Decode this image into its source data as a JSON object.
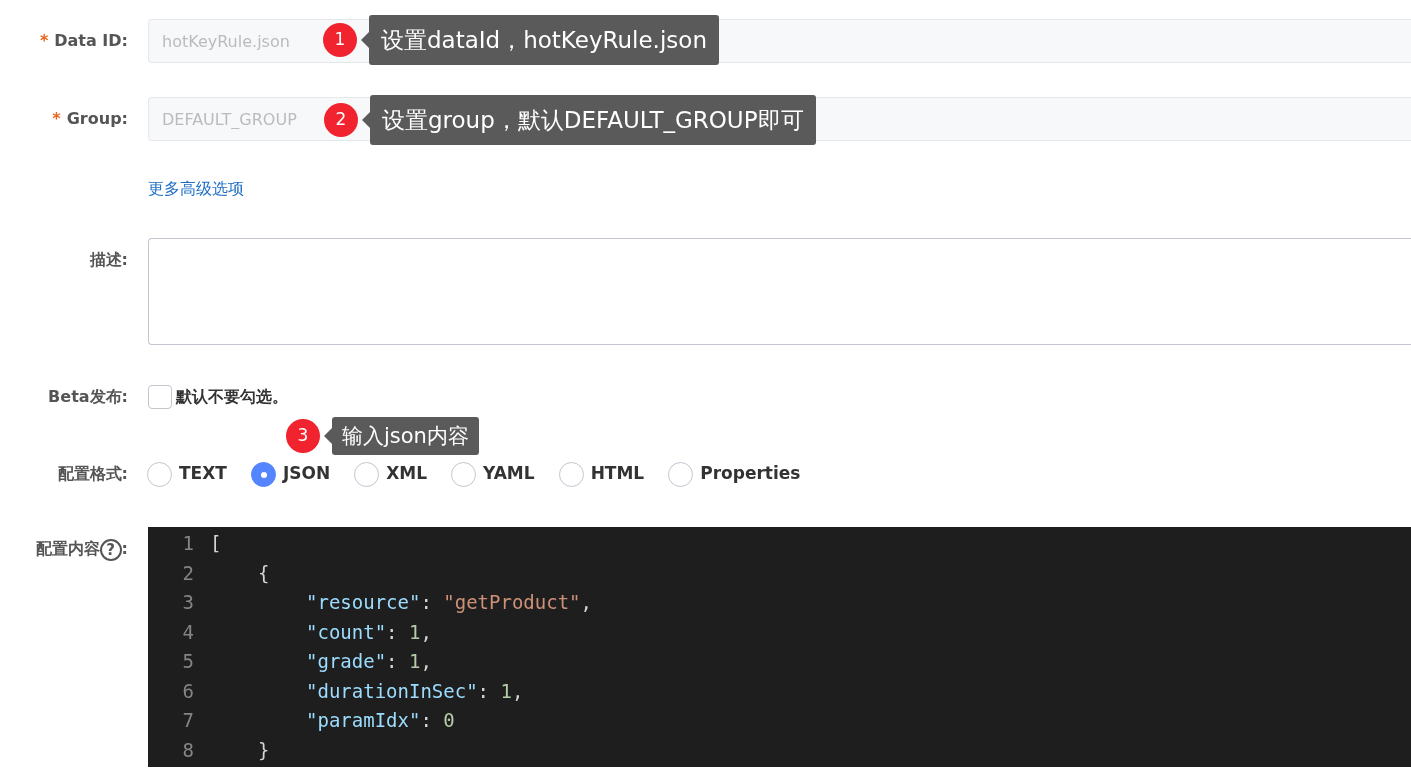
{
  "fields": [
    {
      "label": "Data ID:",
      "required_mark": "*",
      "value": "hotKeyRule.json",
      "disabled": true
    },
    {
      "label": "Group:",
      "required_mark": "*",
      "value": "DEFAULT_GROUP",
      "disabled": true
    }
  ],
  "advanced_link": "更多高级选项",
  "description": {
    "label": "描述:"
  },
  "beta": {
    "label": "Beta发布:",
    "checked": false,
    "text": "默认不要勾选。"
  },
  "format": {
    "label": "配置格式:",
    "options": [
      {
        "label": "TEXT",
        "selected": false
      },
      {
        "label": "JSON",
        "selected": true
      },
      {
        "label": "XML",
        "selected": false
      },
      {
        "label": "YAML",
        "selected": false
      },
      {
        "label": "HTML",
        "selected": false
      },
      {
        "label": "Properties",
        "selected": false
      }
    ]
  },
  "content": {
    "label": "配置内容",
    "help": "?",
    "suffix": ":",
    "lines": [
      {
        "number": "1",
        "tokens": [
          {
            "kind": "punct",
            "text": "["
          }
        ],
        "children": [
          {
            "number": "2",
            "tokens": [
              {
                "kind": "punct",
                "text": "{"
              }
            ],
            "children": [
              {
                "number": "3",
                "tokens": [
                  {
                    "kind": "key",
                    "text": "\"resource\""
                  },
                  {
                    "kind": "punct",
                    "text": ": "
                  },
                  {
                    "kind": "string",
                    "text": "\"getProduct\""
                  },
                  {
                    "kind": "punct",
                    "text": ","
                  }
                ]
              },
              {
                "number": "4",
                "tokens": [
                  {
                    "kind": "key",
                    "text": "\"count\""
                  },
                  {
                    "kind": "punct",
                    "text": ": "
                  },
                  {
                    "kind": "number",
                    "text": "1"
                  },
                  {
                    "kind": "punct",
                    "text": ","
                  }
                ]
              },
              {
                "number": "5",
                "tokens": [
                  {
                    "kind": "key",
                    "text": "\"grade\""
                  },
                  {
                    "kind": "punct",
                    "text": ": "
                  },
                  {
                    "kind": "number",
                    "text": "1"
                  },
                  {
                    "kind": "punct",
                    "text": ","
                  }
                ]
              },
              {
                "number": "6",
                "tokens": [
                  {
                    "kind": "key",
                    "text": "\"durationInSec\""
                  },
                  {
                    "kind": "punct",
                    "text": ": "
                  },
                  {
                    "kind": "number",
                    "text": "1"
                  },
                  {
                    "kind": "punct",
                    "text": ","
                  }
                ]
              },
              {
                "number": "7",
                "tokens": [
                  {
                    "kind": "key",
                    "text": "\"paramIdx\""
                  },
                  {
                    "kind": "punct",
                    "text": ": "
                  },
                  {
                    "kind": "number",
                    "text": "0"
                  }
                ]
              }
            ]
          },
          {
            "number": "8",
            "tokens": [
              {
                "kind": "punct",
                "text": "}"
              }
            ]
          }
        ]
      }
    ]
  },
  "callouts": [
    {
      "number": "1",
      "text": "设置dataId，hotKeyRule.json"
    },
    {
      "number": "2",
      "text": "设置group，默认DEFAULT_GROUP即可"
    },
    {
      "number": "3",
      "text": "输入json内容"
    }
  ]
}
